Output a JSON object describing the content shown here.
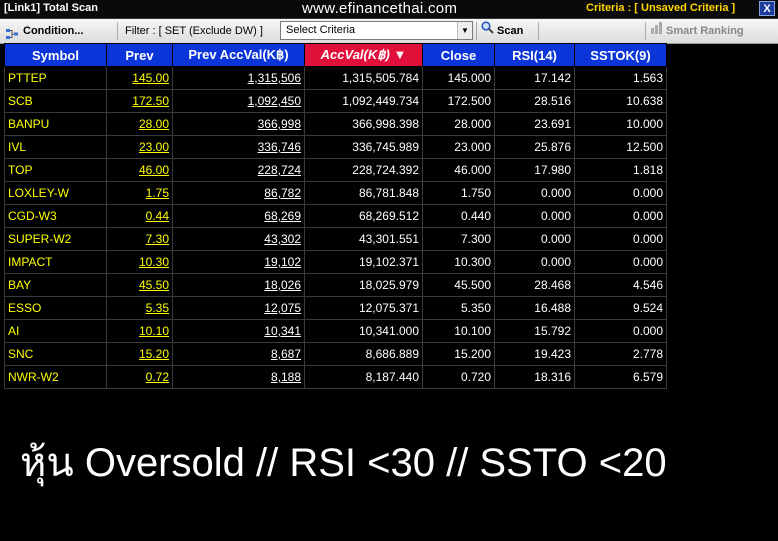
{
  "window": {
    "title": "[Link1] Total Scan",
    "watermark": "www.efinancethai.com",
    "criteria_status": "Criteria : [ Unsaved Criteria ]",
    "close_label": "X"
  },
  "toolbar": {
    "condition_label": "Condition...",
    "filter_label": "Filter : [ SET (Exclude DW) ]",
    "select_value": "Select Criteria",
    "scan_label": "Scan",
    "smart_ranking_label": "Smart Ranking"
  },
  "table": {
    "columns": [
      "Symbol",
      "Prev",
      "Prev AccVal(K฿)",
      "AccVal(K฿) ▼",
      "Close",
      "RSI(14)",
      "SSTOK(9)"
    ],
    "rows": [
      [
        "PTTEP",
        "145.00",
        "1,315,506",
        "1,315,505.784",
        "145.000",
        "17.142",
        "1.563"
      ],
      [
        "SCB",
        "172.50",
        "1,092,450",
        "1,092,449.734",
        "172.500",
        "28.516",
        "10.638"
      ],
      [
        "BANPU",
        "28.00",
        "366,998",
        "366,998.398",
        "28.000",
        "23.691",
        "10.000"
      ],
      [
        "IVL",
        "23.00",
        "336,746",
        "336,745.989",
        "23.000",
        "25.876",
        "12.500"
      ],
      [
        "TOP",
        "46.00",
        "228,724",
        "228,724.392",
        "46.000",
        "17.980",
        "1.818"
      ],
      [
        "LOXLEY-W",
        "1.75",
        "86,782",
        "86,781.848",
        "1.750",
        "0.000",
        "0.000"
      ],
      [
        "CGD-W3",
        "0.44",
        "68,269",
        "68,269.512",
        "0.440",
        "0.000",
        "0.000"
      ],
      [
        "SUPER-W2",
        "7.30",
        "43,302",
        "43,301.551",
        "7.300",
        "0.000",
        "0.000"
      ],
      [
        "IMPACT",
        "10.30",
        "19,102",
        "19,102.371",
        "10.300",
        "0.000",
        "0.000"
      ],
      [
        "BAY",
        "45.50",
        "18,026",
        "18,025.979",
        "45.500",
        "28.468",
        "4.546"
      ],
      [
        "ESSO",
        "5.35",
        "12,075",
        "12,075.371",
        "5.350",
        "16.488",
        "9.524"
      ],
      [
        "AI",
        "10.10",
        "10,341",
        "10,341.000",
        "10.100",
        "15.792",
        "0.000"
      ],
      [
        "SNC",
        "15.20",
        "8,687",
        "8,686.889",
        "15.200",
        "19.423",
        "2.778"
      ],
      [
        "NWR-W2",
        "0.72",
        "8,188",
        "8,187.440",
        "0.720",
        "18.316",
        "6.579"
      ]
    ]
  },
  "caption": "หุ้น Oversold // RSI <30 // SSTO <20",
  "colors": {
    "header_bg": "#0b35d9",
    "sorted_header_bg": "#e0103a",
    "symbol_text": "#ffff00",
    "criteria_text": "#ffd700"
  }
}
